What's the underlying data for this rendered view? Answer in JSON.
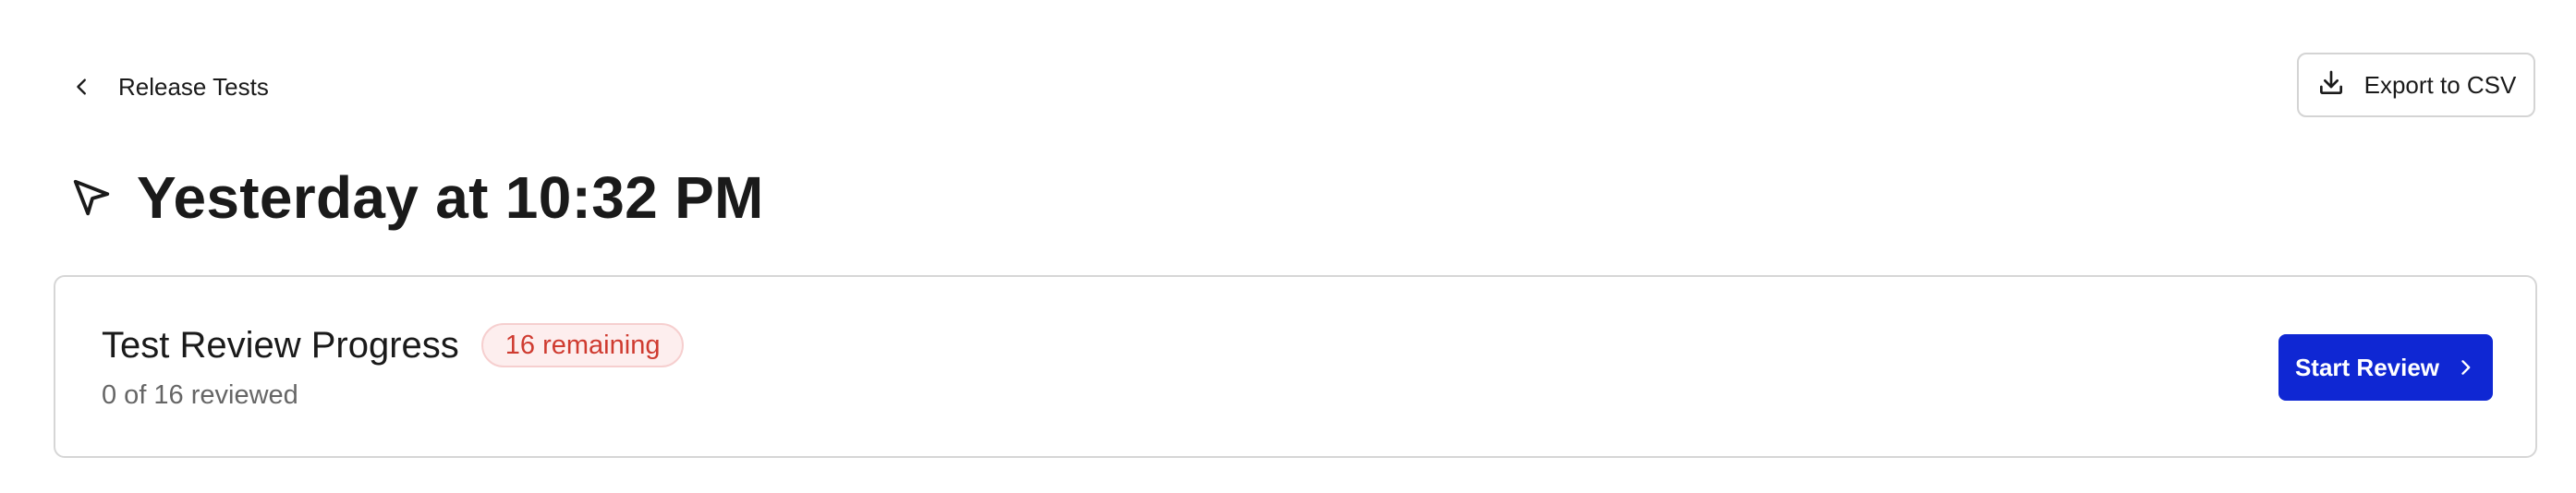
{
  "header": {
    "back_label": "Release Tests",
    "export_label": "Export to CSV"
  },
  "page": {
    "title": "Yesterday at 10:32 PM"
  },
  "progress": {
    "title": "Test Review Progress",
    "remaining_badge": "16 remaining",
    "reviewed_text": "0 of 16 reviewed",
    "reviewed_count": 0,
    "total_count": 16,
    "start_label": "Start Review"
  },
  "colors": {
    "accent": "#0f27d3",
    "badge_text": "#cf3b30",
    "badge_bg": "#fdeeee",
    "border": "#d6d6d6"
  },
  "icons": {
    "back": "chevron-left-icon",
    "export": "download-icon",
    "title": "cursor-arrow-icon",
    "start": "chevron-right-icon"
  }
}
